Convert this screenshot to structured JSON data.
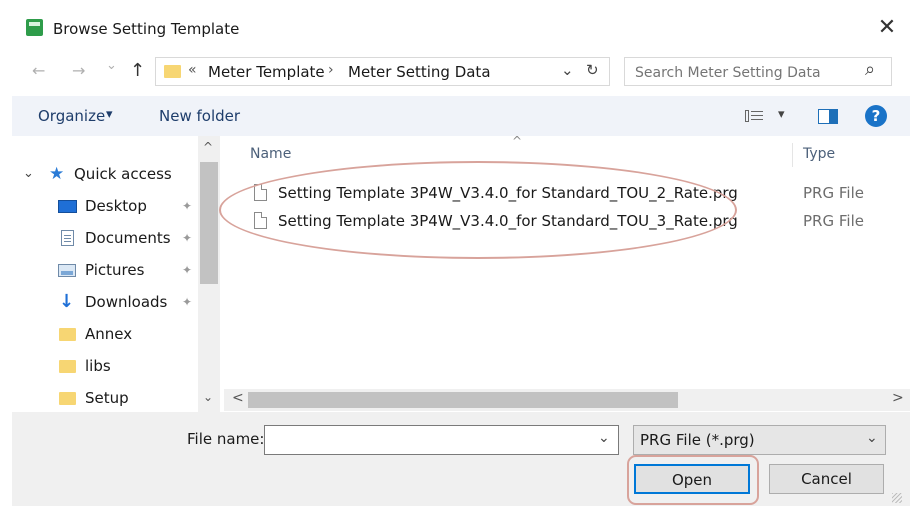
{
  "window": {
    "title": "Browse Setting Template",
    "close_label": "✕"
  },
  "nav": {
    "back": "←",
    "forward": "→",
    "recent": "⌄",
    "up": "↑",
    "path_prefix": "«",
    "breadcrumb": [
      "Meter Template",
      "Meter Setting Data"
    ],
    "separator": "›",
    "dropdown": "⌄",
    "refresh": "↻",
    "search_placeholder": "Search Meter Setting Data",
    "search_icon": "⌕"
  },
  "toolbar": {
    "organize": "Organize",
    "organize_arrow": "▾",
    "new_folder": "New folder",
    "view_arrow": "▾",
    "help": "?"
  },
  "sidebar": {
    "items": [
      {
        "label": "Quick access",
        "icon": "star-icon"
      },
      {
        "label": "Desktop",
        "icon": "desktop-icon",
        "pinned": true
      },
      {
        "label": "Documents",
        "icon": "documents-icon",
        "pinned": true
      },
      {
        "label": "Pictures",
        "icon": "pictures-icon",
        "pinned": true
      },
      {
        "label": "Downloads",
        "icon": "downloads-icon",
        "pinned": true
      },
      {
        "label": "Annex",
        "icon": "folder-icon"
      },
      {
        "label": "libs",
        "icon": "folder-icon"
      },
      {
        "label": "Setup",
        "icon": "folder-icon"
      }
    ],
    "expand": "⌄",
    "pin": "📌"
  },
  "file_list": {
    "sort_indicator": "^",
    "columns": {
      "name": "Name",
      "type": "Type"
    },
    "files": [
      {
        "name": "Setting Template 3P4W_V3.4.0_for Standard_TOU_2_Rate.prg",
        "type": "PRG File"
      },
      {
        "name": "Setting Template 3P4W_V3.4.0_for Standard_TOU_3_Rate.prg",
        "type": "PRG File"
      }
    ]
  },
  "scroll": {
    "up": "^",
    "down": "⌄",
    "left": "<",
    "right": ">"
  },
  "footer": {
    "filename_label": "File name:",
    "filename_value": "",
    "filetype_value": "PRG File (*.prg)",
    "combo_arrow": "⌄",
    "open": "Open",
    "cancel": "Cancel"
  },
  "colors": {
    "accent": "#0078d7",
    "annotation": "#d8a39b",
    "help": "#1a73c8"
  }
}
